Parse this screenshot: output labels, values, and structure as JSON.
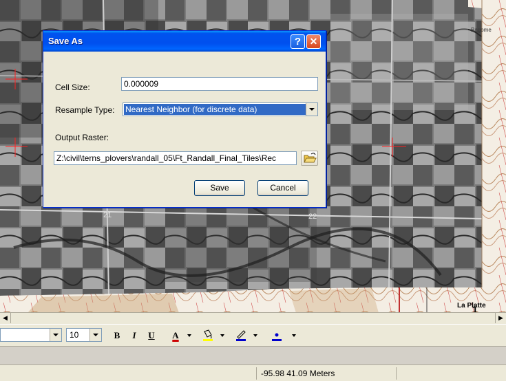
{
  "map": {
    "section_labels": [
      "21",
      "22"
    ],
    "place_name": "La Platte",
    "place_number": "1",
    "corner_text": "Bagome"
  },
  "dialog": {
    "title": "Save As",
    "help_label": "?",
    "close_label": "✕",
    "cell_size_label": "Cell Size:",
    "cell_size_value": "0.000009",
    "resample_label": "Resample Type:",
    "resample_value": "Nearest Neighbor (for discrete data)",
    "output_label": "Output Raster:",
    "output_value": "Z:\\civil\\terns_plovers\\randall_05\\Ft_Randall_Final_Tiles\\Rec",
    "save_label": "Save",
    "cancel_label": "Cancel"
  },
  "toolbar": {
    "font_size": "10",
    "bold_label": "B",
    "italic_label": "I",
    "underline_label": "U",
    "font_color_label": "A",
    "colors": {
      "font_color": "#cc0000",
      "fill_color": "#ffff00",
      "line_color": "#0000cc",
      "marker_color": "#0000cc"
    }
  },
  "statusbar": {
    "coordinates": "-95.98  41.09 Meters"
  },
  "icons": [
    "help-icon",
    "close-icon",
    "open-folder-icon",
    "font-color-icon",
    "fill-color-icon",
    "line-color-icon",
    "marker-color-icon",
    "chevron-down-icon"
  ]
}
